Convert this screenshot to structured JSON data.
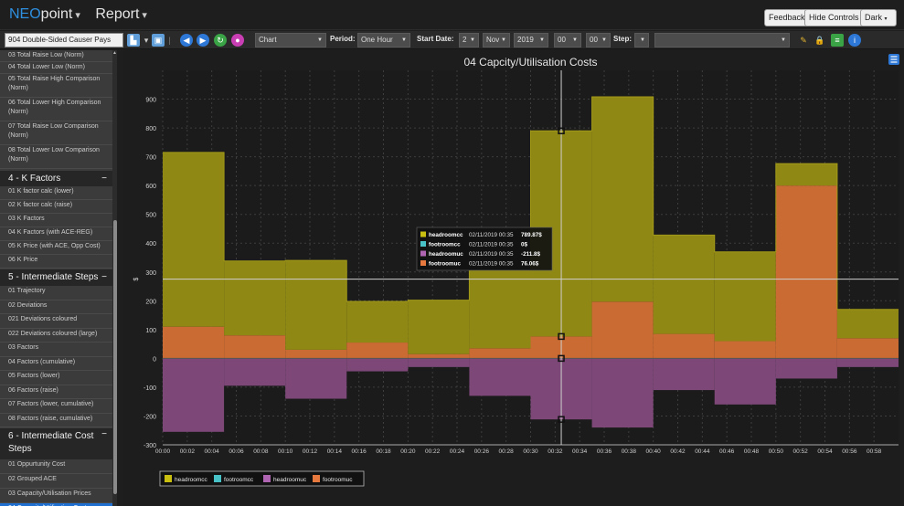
{
  "app": {
    "brand_a": "NEO",
    "brand_b": "point",
    "menu_report": "Report"
  },
  "header_buttons": {
    "feedback": "Feedback",
    "hide_controls": "Hide Controls",
    "theme": "Dark"
  },
  "toolbar": {
    "report_select": "904 Double-Sided Causer Pays",
    "view_select": "Chart",
    "period_label": "Period:",
    "period_value": "One Hour",
    "start_date_label": "Start Date:",
    "day": "2",
    "month": "Nov",
    "year": "2019",
    "hour": "00",
    "minute": "00",
    "step_label": "Step:",
    "step_value": "",
    "filter_value": ""
  },
  "sidebar": {
    "pre_items": [
      "03 Total Raise Low (Norm)",
      "04 Total Lower Low (Norm)",
      "05 Total Raise High Comparison (Norm)",
      "06 Total Lower High Comparison (Norm)",
      "07 Total Raise Low Comparison (Norm)",
      "08 Total Lower Low Comparison (Norm)"
    ],
    "sec4": "4 - K Factors",
    "sec4_items": [
      "01 K factor calc (lower)",
      "02 K factor calc (raise)",
      "03 K Factors",
      "04 K Factors (with ACE-REG)",
      "05 K Price (with ACE, Opp Cost)",
      "06 K Price"
    ],
    "sec5": "5 - Intermediate Steps",
    "sec5_items": [
      "01 Trajectory",
      "02 Deviations",
      "021 Deviations coloured",
      "022 Deviations coloured (large)",
      "03 Factors",
      "04 Factors (cumulative)",
      "05 Factors (lower)",
      "06 Factors (raise)",
      "07 Factors (lower, cumulative)",
      "08 Factors (raise, cumulative)"
    ],
    "sec6": "6 - Intermediate Cost Steps",
    "sec6_items": [
      "01 Oppurtunity Cost",
      "02 Grouped ACE",
      "03 Capacity/Utilisation Prices",
      "04 Capacity/Utilisation Costs"
    ],
    "collapse_symbol": "−"
  },
  "chart_data": {
    "type": "area",
    "title": "04 Capcity/Utilisation Costs",
    "ylabel": "$",
    "xlabel": "",
    "ylim": [
      -300,
      1000
    ],
    "yticks": [
      -300,
      -200,
      -100,
      0,
      100,
      200,
      300,
      400,
      500,
      600,
      700,
      800,
      900
    ],
    "xticks": [
      "00:00",
      "00:02",
      "00:04",
      "00:06",
      "00:08",
      "00:10",
      "00:12",
      "00:14",
      "00:16",
      "00:18",
      "00:20",
      "00:22",
      "00:24",
      "00:26",
      "00:28",
      "00:30",
      "00:32",
      "00:34",
      "00:36",
      "00:38",
      "00:40",
      "00:42",
      "00:44",
      "00:46",
      "00:48",
      "00:50",
      "00:52",
      "00:54",
      "00:56",
      "00:58"
    ],
    "grid": true,
    "legend_position": "bottom-left",
    "step": true,
    "interval_starts_min": [
      0,
      5,
      10,
      15,
      20,
      25,
      30,
      35,
      40,
      45,
      50,
      55
    ],
    "interval_end_min": 60,
    "series": [
      {
        "name": "headroomcc",
        "color": "#c9bf10",
        "values": [
          715,
          338,
          340,
          198,
          202,
          306,
          789.87,
          908,
          428,
          370,
          676,
          170
        ]
      },
      {
        "name": "footroomcc",
        "color": "#49c2c7",
        "values": [
          0,
          0,
          0,
          0,
          0,
          0,
          0,
          0,
          0,
          0,
          0,
          0
        ]
      },
      {
        "name": "headroomuc",
        "color": "#b065b3",
        "values": [
          -255,
          -95,
          -140,
          -45,
          -30,
          -130,
          -211.8,
          -240,
          -110,
          -160,
          -70,
          -30
        ]
      },
      {
        "name": "footroomuc",
        "color": "#e8793e",
        "values": [
          110,
          80,
          30,
          55,
          15,
          35,
          76.06,
          197,
          85,
          60,
          600,
          70
        ]
      }
    ],
    "tooltip": {
      "rows": [
        {
          "series": "headroomcc",
          "time": "02/11/2019 00:35",
          "value": "789.87$"
        },
        {
          "series": "footroomcc",
          "time": "02/11/2019 00:35",
          "value": "0$"
        },
        {
          "series": "headroomuc",
          "time": "02/11/2019 00:35",
          "value": "-211.8$"
        },
        {
          "series": "footroomuc",
          "time": "02/11/2019 00:35",
          "value": "76.06$"
        }
      ]
    },
    "crosshair": {
      "x_min": 32.5,
      "y": 275
    }
  },
  "colors": {
    "accent": "#2f8fe0",
    "active_item": "#1f6fd1"
  },
  "icons": [
    "chart-type-icon",
    "save-icon",
    "back-icon",
    "forward-icon",
    "refresh-icon",
    "record-icon",
    "pin-icon",
    "lock-icon",
    "table-icon",
    "info-icon",
    "menu-icon"
  ]
}
